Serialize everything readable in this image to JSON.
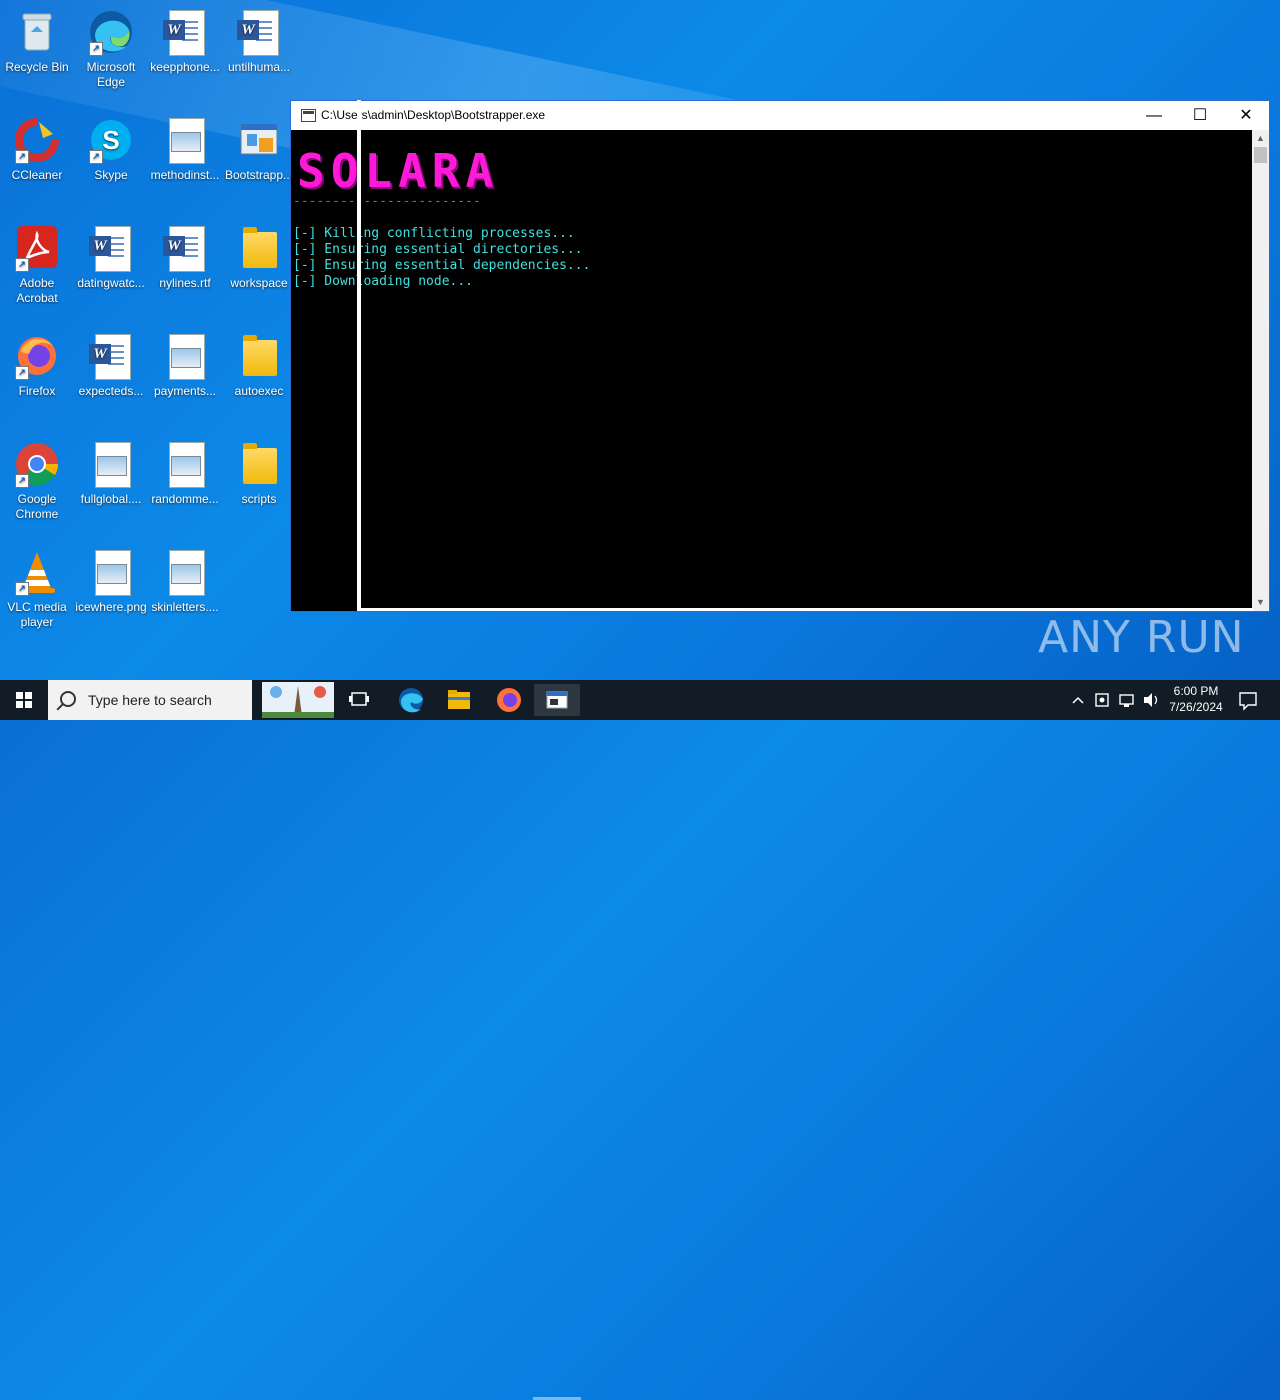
{
  "desktop": {
    "icons": [
      {
        "label": "Recycle Bin"
      },
      {
        "label": "Microsoft Edge"
      },
      {
        "label": "keepphone..."
      },
      {
        "label": "untilhuma..."
      },
      {
        "label": "CCleaner"
      },
      {
        "label": "Skype"
      },
      {
        "label": "methodinst..."
      },
      {
        "label": "Bootstrapp..."
      },
      {
        "label": "Adobe Acrobat"
      },
      {
        "label": "datingwatc..."
      },
      {
        "label": "nylines.rtf"
      },
      {
        "label": "workspace"
      },
      {
        "label": "Firefox"
      },
      {
        "label": "expecteds..."
      },
      {
        "label": "payments..."
      },
      {
        "label": "autoexec"
      },
      {
        "label": "Google Chrome"
      },
      {
        "label": "fullglobal...."
      },
      {
        "label": "randomme..."
      },
      {
        "label": "scripts"
      },
      {
        "label": "VLC media player"
      },
      {
        "label": "icewhere.png"
      },
      {
        "label": "skinletters...."
      }
    ]
  },
  "console": {
    "title": "C:\\Users\\admin\\Desktop\\Bootstrapper.exe",
    "logo": "SOLARA",
    "separator": "------------------------",
    "lines": [
      "[-] Killing conflicting processes...",
      "[-] Ensuring essential directories...",
      "[-] Ensuring essential dependencies...",
      "[-] Downloading node..."
    ],
    "minimize": "—",
    "maximize": "☐",
    "close": "✕"
  },
  "watermark": "ANY RUN",
  "taskbar": {
    "search_placeholder": "Type here to search",
    "time": "6:00 PM",
    "date": "7/26/2024"
  },
  "colors": {
    "logo": "#ff1ad9",
    "console_text": "#3fe0e0",
    "taskbar": "#111c26"
  }
}
